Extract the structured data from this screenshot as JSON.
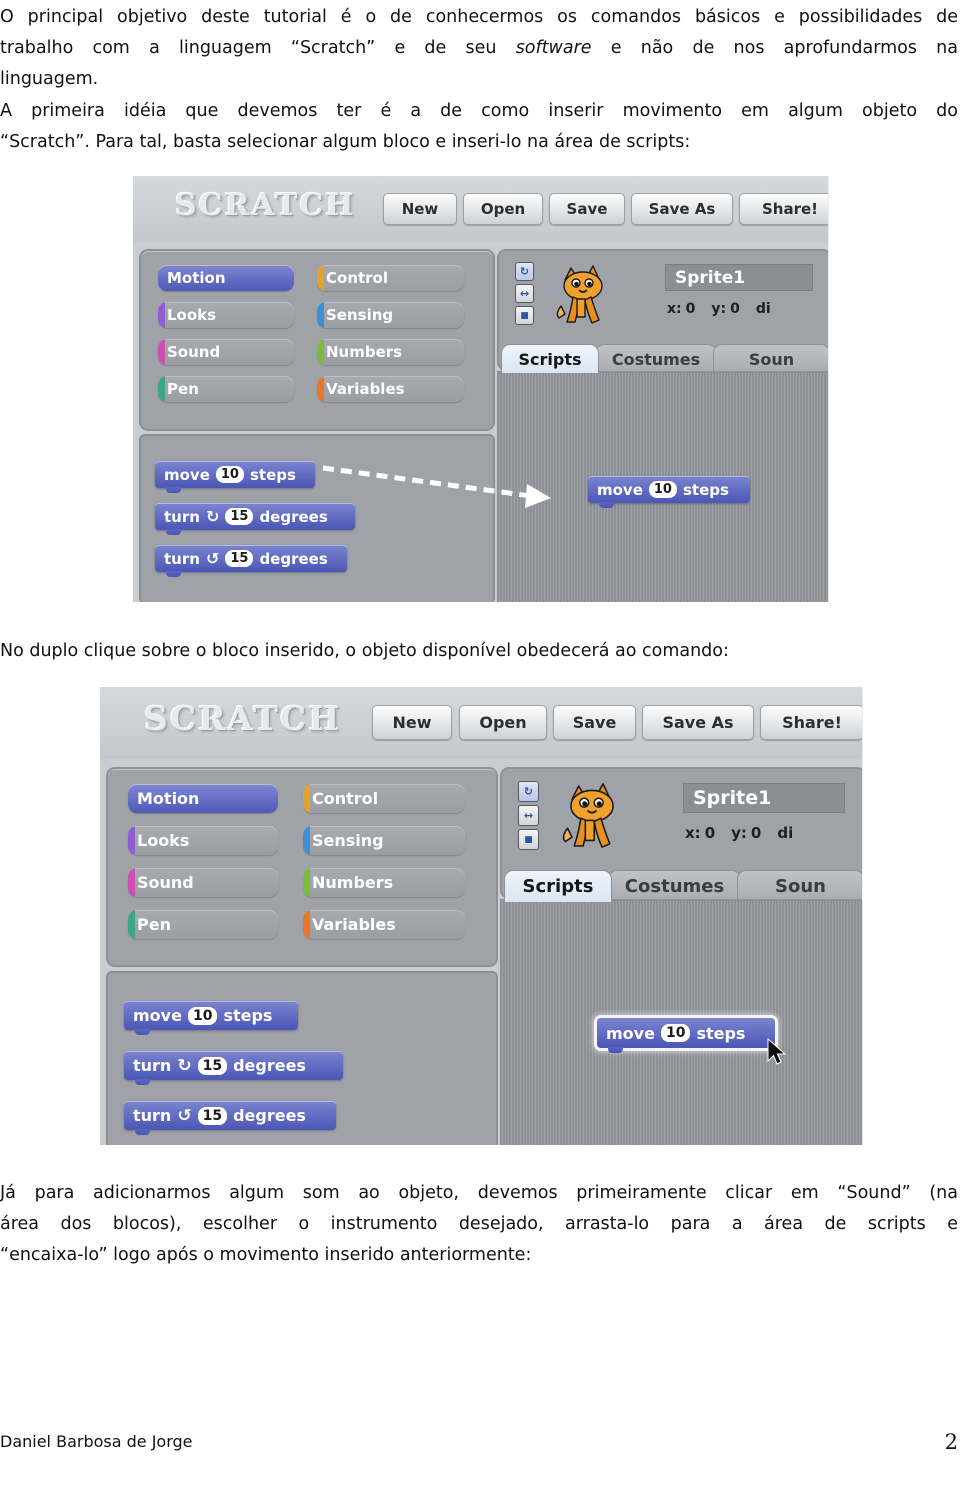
{
  "document": {
    "paragraph1": {
      "line1": "O principal objetivo deste tutorial é o de conhecermos os comandos básicos e possibilidades de",
      "line2_a": "trabalho com a linguagem “Scratch” e de seu ",
      "line2_italic": "software",
      "line2_b": " e não de nos aprofundarmos na",
      "line3": "linguagem."
    },
    "paragraph2": {
      "line1": "A primeira idéia que devemos ter é a de como inserir movimento em algum objeto do",
      "line2": "“Scratch”. Para tal, basta selecionar algum bloco e inseri-lo na área de scripts:"
    },
    "paragraph3": {
      "line1": "No duplo clique sobre o bloco inserido, o objeto disponível obedecerá ao comando:"
    },
    "paragraph4": {
      "line1": "Já para adicionarmos algum som ao objeto, devemos primeiramente clicar em “Sound” (na",
      "line2": "área dos blocos), escolher o instrumento desejado, arrasta-lo para a área de scripts e",
      "line3": "“encaixa-lo” logo após o movimento inserido anteriormente:"
    },
    "footer": {
      "author": "Daniel Barbosa de Jorge",
      "page_number": "2"
    }
  },
  "scratch": {
    "logo": "SCRATCH",
    "toolbar_buttons": [
      "New",
      "Open",
      "Save",
      "Save As",
      "Share!"
    ],
    "categories_left": [
      {
        "label": "Motion",
        "color": "#4b56b6",
        "selected": true
      },
      {
        "label": "Looks",
        "color": "#8e5fd0",
        "selected": false
      },
      {
        "label": "Sound",
        "color": "#cd4fb0",
        "selected": false
      },
      {
        "label": "Pen",
        "color": "#3da58a",
        "selected": false
      }
    ],
    "categories_right": [
      {
        "label": "Control",
        "color": "#e2a32b",
        "selected": false
      },
      {
        "label": "Sensing",
        "color": "#3d8fd6",
        "selected": false
      },
      {
        "label": "Numbers",
        "color": "#7bbd3a",
        "selected": false
      },
      {
        "label": "Variables",
        "color": "#e8762b",
        "selected": false
      }
    ],
    "palette_blocks": [
      {
        "prefix": "move",
        "value": "10",
        "suffix": "steps",
        "glyph": ""
      },
      {
        "prefix": "turn",
        "value": "15",
        "suffix": "degrees",
        "glyph": "↻"
      },
      {
        "prefix": "turn",
        "value": "15",
        "suffix": "degrees",
        "glyph": "↺"
      }
    ],
    "script_block": {
      "prefix": "move",
      "value": "10",
      "suffix": "steps"
    },
    "sprite": {
      "name": "Sprite1",
      "x_label": "x:",
      "x_value": "0",
      "y_label": "y:",
      "y_value": "0",
      "direction_label": "di"
    },
    "tabs": [
      {
        "label": "Scripts",
        "active": true
      },
      {
        "label": "Costumes",
        "active": false
      },
      {
        "label": "Soun",
        "active": false
      }
    ],
    "rotation_buttons": [
      "rotate",
      "flip",
      "dot"
    ]
  }
}
